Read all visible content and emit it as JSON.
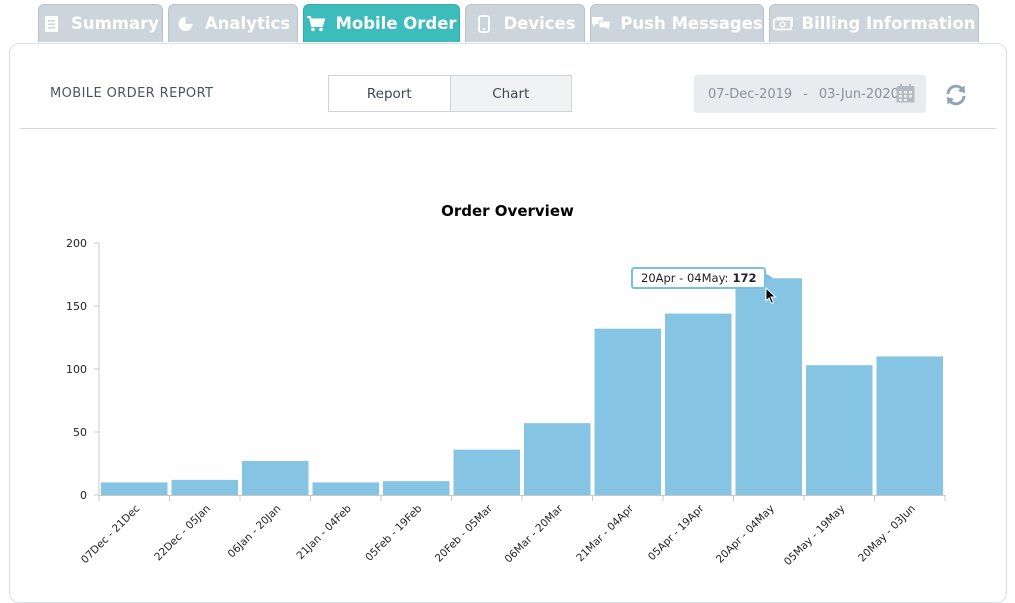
{
  "tabs": [
    {
      "label": "Summary",
      "icon": "document-icon",
      "active": false
    },
    {
      "label": "Analytics",
      "icon": "pie-chart-icon",
      "active": false
    },
    {
      "label": "Mobile Order",
      "icon": "cart-icon",
      "active": true
    },
    {
      "label": "Devices",
      "icon": "mobile-device-icon",
      "active": false
    },
    {
      "label": "Push Messages",
      "icon": "chat-bubbles-icon",
      "active": false
    },
    {
      "label": "Billing Information",
      "icon": "money-icon",
      "active": false
    }
  ],
  "header": {
    "title": "MOBILE ORDER REPORT",
    "toggle": {
      "report_label": "Report",
      "chart_label": "Chart",
      "selected": "Chart"
    },
    "date_range": {
      "start": "07-Dec-2019",
      "separator": "-",
      "end": "03-Jun-2020"
    }
  },
  "tooltip": {
    "label": "20Apr - 04May:",
    "value": "172"
  },
  "colors": {
    "accent": "#3cbcba",
    "bar": "#86c4e4",
    "tab_inactive": "#cdd5dc",
    "tooltip_border": "#7cc0e0"
  },
  "chart_data": {
    "type": "bar",
    "title": "Order Overview",
    "xlabel": "",
    "ylabel": "",
    "ylim": [
      0,
      200
    ],
    "yticks": [
      0,
      50,
      100,
      150,
      200
    ],
    "grid": false,
    "categories": [
      "07Dec - 21Dec",
      "22Dec - 05Jan",
      "06Jan - 20Jan",
      "21Jan - 04Feb",
      "05Feb - 19Feb",
      "20Feb - 05Mar",
      "06Mar - 20Mar",
      "21Mar - 04Apr",
      "05Apr - 19Apr",
      "20Apr - 04May",
      "05May - 19May",
      "20May - 03Jun"
    ],
    "values": [
      10,
      12,
      27,
      10,
      11,
      36,
      57,
      132,
      144,
      172,
      103,
      110
    ]
  }
}
